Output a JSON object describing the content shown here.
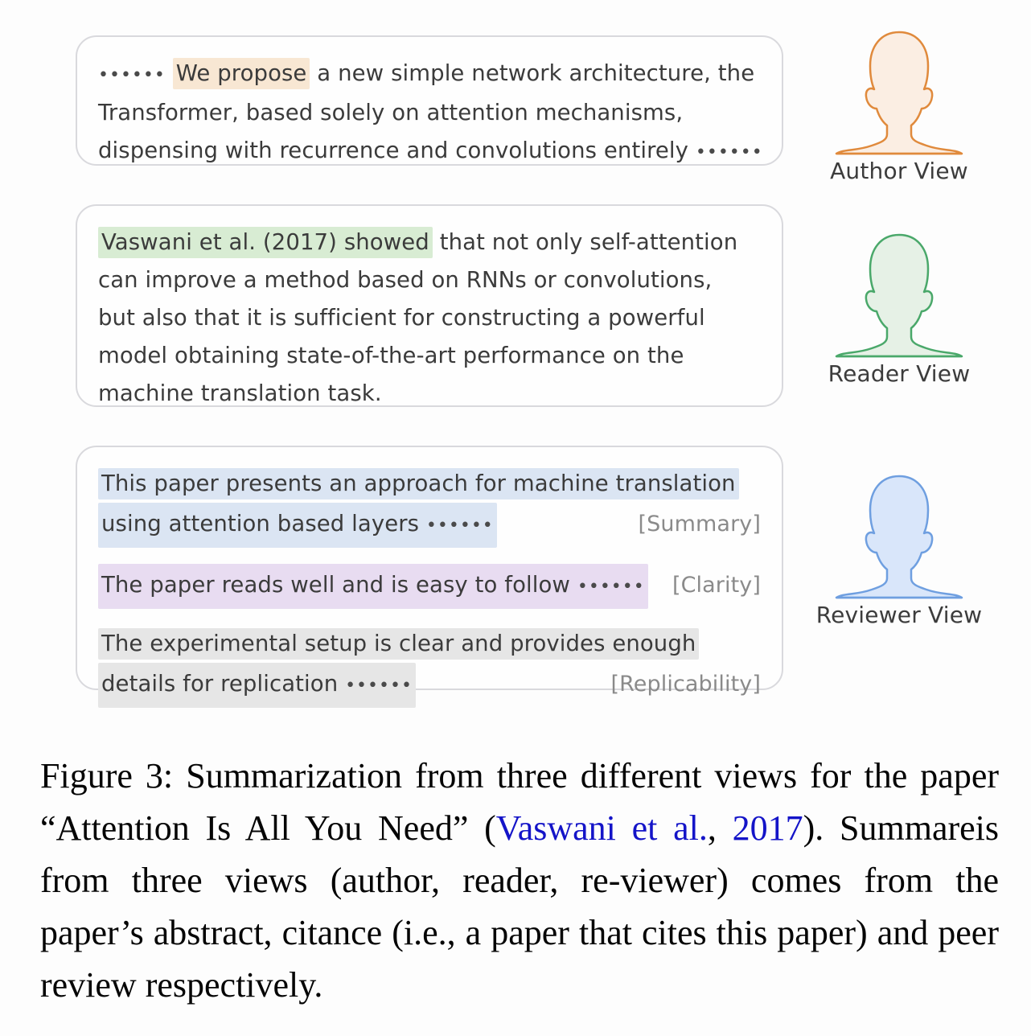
{
  "figure": {
    "caption_prefix": "Figure 3:",
    "caption_part1": " Summarization from three different views for the paper “Attention Is All You Need” (",
    "caption_cite_author": "Vaswani et al.",
    "caption_cite_sep": ", ",
    "caption_cite_year": "2017",
    "caption_part2": "). Summareis from three views (author, reader, re-viewer) comes from the paper’s abstract, citance (i.e., a paper that cites this paper) and peer review respectively."
  },
  "colors": {
    "highlight_author": "#f8e7d3",
    "highlight_reader": "#d8ecd3",
    "highlight_summary": "#dbe5f3",
    "highlight_clarity": "#e8dcf1",
    "highlight_replicability": "#e6e6e6",
    "avatar_author_stroke": "#e08a3c",
    "avatar_author_fill": "#fbeee3",
    "avatar_reader_stroke": "#4aa86a",
    "avatar_reader_fill": "#e6f1e6",
    "avatar_reviewer_stroke": "#6f9fe0",
    "avatar_reviewer_fill": "#d9e6fa",
    "box_border": "#d9d9dd",
    "text": "#3b3b3b",
    "tag_text": "#8a8a8a",
    "citation_link": "#1414c8"
  },
  "views": [
    {
      "id": "author",
      "label": "Author View",
      "icon": "person-silhouette-icon",
      "highlight_color": "#f8e7d3"
    },
    {
      "id": "reader",
      "label": "Reader View",
      "icon": "person-silhouette-icon",
      "highlight_color": "#d8ecd3"
    },
    {
      "id": "reviewer",
      "label": "Reviewer View",
      "icon": "person-silhouette-icon",
      "highlight_color": "#dbe5f3"
    }
  ],
  "author_box": {
    "leading_ellipsis": "••••••",
    "line1_highlight": "We propose",
    "line1_rest": " a new simple network architecture, the",
    "line2": "Transformer,  based  solely  on  attention  mechanisms,",
    "line3": "dispensing with recurrence and convolutions entirely",
    "trailing_ellipsis": "••••••"
  },
  "reader_box": {
    "line1_highlight": "Vaswani et al. (2017) showed",
    "line1_rest": " that not only self-attention",
    "line2": "can improve a method based on RNNs or convolutions,",
    "line3": "but also that it is sufficient for constructing a powerful",
    "line4": "model  obtaining  state-of-the-art  performance  on  the",
    "line5": "machine translation task."
  },
  "reviewer_box": {
    "items": [
      {
        "tag": "[Summary]",
        "highlight": "#dbe5f3",
        "line1": "This paper presents an approach for machine translation",
        "line2": "using attention based layers",
        "ellipsis": "••••••"
      },
      {
        "tag": "[Clarity]",
        "highlight": "#e8dcf1",
        "line1": "The paper reads well and is easy to follow",
        "line2": "",
        "ellipsis": "••••••"
      },
      {
        "tag": "[Replicability]",
        "highlight": "#e6e6e6",
        "line1": "The  experimental  setup  is  clear  and  provides  enough",
        "line2": "details for replication",
        "ellipsis": "••••••"
      }
    ]
  }
}
